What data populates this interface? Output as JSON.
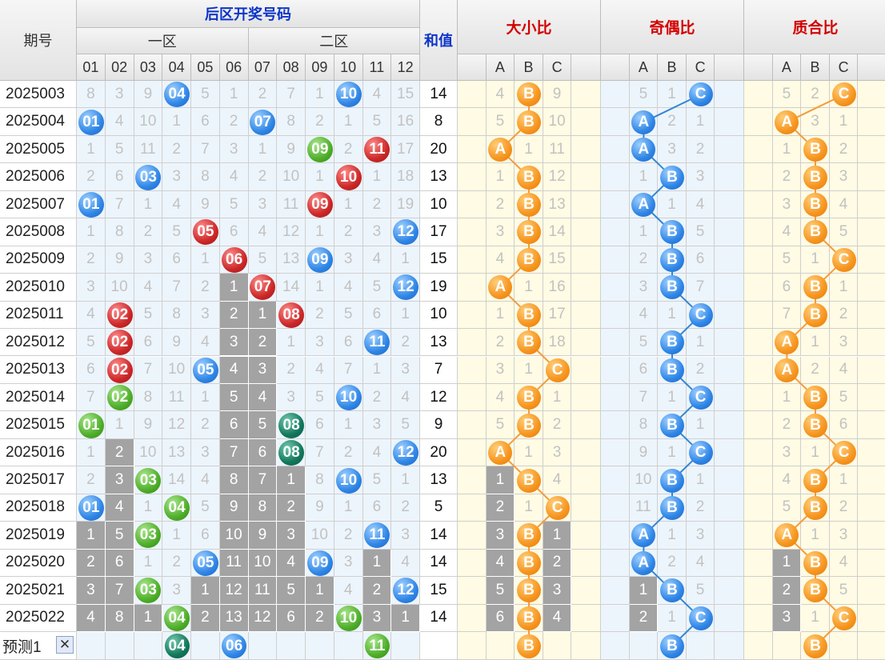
{
  "header": {
    "period_label": "期号",
    "back_zone_label": "后区开奖号码",
    "zone1_label": "一区",
    "zone2_label": "二区",
    "sum_label": "和值",
    "ratio_titles": [
      "大小比",
      "奇偶比",
      "质合比"
    ],
    "abc_labels": [
      "A",
      "B",
      "C"
    ],
    "number_labels": [
      "01",
      "02",
      "03",
      "04",
      "05",
      "06",
      "07",
      "08",
      "09",
      "10",
      "11",
      "12"
    ]
  },
  "colors": {
    "blue": "#2f86e6",
    "red": "#cc2828",
    "green": "#4fae2a",
    "teal": "#12775c",
    "orange": "#f6951f",
    "gray": "#a3a3a3",
    "line_orange": "#f49b3c",
    "line_blue": "#3487d3"
  },
  "chart_data": {
    "type": "table",
    "rows": [
      {
        "period": "2025003",
        "cells": [
          8,
          3,
          9,
          "04",
          5,
          1,
          2,
          7,
          1,
          "10",
          4,
          15
        ],
        "sum": 14,
        "dx": [
          4,
          "B",
          9
        ],
        "jo": [
          5,
          1,
          "C"
        ],
        "zh": [
          5,
          2,
          "C"
        ]
      },
      {
        "period": "2025004",
        "cells": [
          "01",
          4,
          10,
          1,
          6,
          2,
          "07",
          8,
          2,
          1,
          5,
          16
        ],
        "sum": 8,
        "dx": [
          5,
          "B",
          10
        ],
        "jo": [
          "A",
          2,
          1
        ],
        "zh": [
          "A",
          3,
          1
        ]
      },
      {
        "period": "2025005",
        "cells": [
          1,
          5,
          11,
          2,
          7,
          3,
          1,
          9,
          "09",
          2,
          "11",
          17
        ],
        "sum": 20,
        "dx": [
          "A",
          1,
          11
        ],
        "jo": [
          "A",
          3,
          2
        ],
        "zh": [
          1,
          "B",
          2
        ]
      },
      {
        "period": "2025006",
        "cells": [
          2,
          6,
          "03",
          3,
          8,
          4,
          2,
          10,
          1,
          "10",
          1,
          18
        ],
        "sum": 13,
        "dx": [
          1,
          "B",
          12
        ],
        "jo": [
          1,
          "B",
          3
        ],
        "zh": [
          2,
          "B",
          3
        ]
      },
      {
        "period": "2025007",
        "cells": [
          "01",
          7,
          1,
          4,
          9,
          5,
          3,
          11,
          "09",
          1,
          2,
          19
        ],
        "sum": 10,
        "dx": [
          2,
          "B",
          13
        ],
        "jo": [
          "A",
          1,
          4
        ],
        "zh": [
          3,
          "B",
          4
        ]
      },
      {
        "period": "2025008",
        "cells": [
          1,
          8,
          2,
          5,
          "05",
          6,
          4,
          12,
          1,
          2,
          3,
          "12"
        ],
        "sum": 17,
        "dx": [
          3,
          "B",
          14
        ],
        "jo": [
          1,
          "B",
          5
        ],
        "zh": [
          4,
          "B",
          5
        ]
      },
      {
        "period": "2025009",
        "cells": [
          2,
          9,
          3,
          6,
          1,
          "06",
          5,
          13,
          "09",
          3,
          4,
          1
        ],
        "sum": 15,
        "dx": [
          4,
          "B",
          15
        ],
        "jo": [
          2,
          "B",
          6
        ],
        "zh": [
          5,
          1,
          "C"
        ]
      },
      {
        "period": "2025010",
        "cells": [
          3,
          10,
          4,
          7,
          2,
          1,
          "07",
          14,
          1,
          4,
          5,
          "12"
        ],
        "sum": 19,
        "dx": [
          "A",
          1,
          16
        ],
        "jo": [
          3,
          "B",
          7
        ],
        "zh": [
          6,
          "B",
          1
        ]
      },
      {
        "period": "2025011",
        "cells": [
          4,
          "02",
          5,
          8,
          3,
          2,
          1,
          "08",
          2,
          5,
          6,
          1
        ],
        "sum": 10,
        "dx": [
          1,
          "B",
          17
        ],
        "jo": [
          4,
          1,
          "C"
        ],
        "zh": [
          7,
          "B",
          2
        ]
      },
      {
        "period": "2025012",
        "cells": [
          5,
          "02",
          6,
          9,
          4,
          3,
          2,
          1,
          3,
          6,
          "11",
          2
        ],
        "sum": 13,
        "dx": [
          2,
          "B",
          18
        ],
        "jo": [
          5,
          "B",
          1
        ],
        "zh": [
          "A",
          1,
          3
        ]
      },
      {
        "period": "2025013",
        "cells": [
          6,
          "02",
          7,
          10,
          "05",
          4,
          3,
          2,
          4,
          7,
          1,
          3
        ],
        "sum": 7,
        "dx": [
          3,
          1,
          "C"
        ],
        "jo": [
          6,
          "B",
          2
        ],
        "zh": [
          "A",
          2,
          4
        ]
      },
      {
        "period": "2025014",
        "cells": [
          7,
          "02",
          8,
          11,
          1,
          5,
          4,
          3,
          5,
          "10",
          2,
          4
        ],
        "sum": 12,
        "dx": [
          4,
          "B",
          1
        ],
        "jo": [
          7,
          1,
          "C"
        ],
        "zh": [
          1,
          "B",
          5
        ]
      },
      {
        "period": "2025015",
        "cells": [
          "01",
          1,
          9,
          12,
          2,
          6,
          5,
          "08",
          6,
          1,
          3,
          5
        ],
        "sum": 9,
        "dx": [
          5,
          "B",
          2
        ],
        "jo": [
          8,
          "B",
          1
        ],
        "zh": [
          2,
          "B",
          6
        ]
      },
      {
        "period": "2025016",
        "cells": [
          1,
          2,
          10,
          13,
          3,
          7,
          6,
          "08",
          7,
          2,
          4,
          "12"
        ],
        "sum": 20,
        "dx": [
          "A",
          1,
          3
        ],
        "jo": [
          9,
          1,
          "C"
        ],
        "zh": [
          3,
          1,
          "C"
        ]
      },
      {
        "period": "2025017",
        "cells": [
          2,
          3,
          "03",
          14,
          4,
          8,
          7,
          1,
          8,
          "10",
          5,
          1
        ],
        "sum": 13,
        "dx": [
          1,
          "B",
          4
        ],
        "jo": [
          10,
          "B",
          1
        ],
        "zh": [
          4,
          "B",
          1
        ]
      },
      {
        "period": "2025018",
        "cells": [
          "01",
          4,
          1,
          "04",
          5,
          9,
          8,
          2,
          9,
          1,
          6,
          2
        ],
        "sum": 5,
        "dx": [
          2,
          1,
          "C"
        ],
        "jo": [
          11,
          "B",
          2
        ],
        "zh": [
          5,
          "B",
          2
        ]
      },
      {
        "period": "2025019",
        "cells": [
          1,
          5,
          "03",
          1,
          6,
          10,
          9,
          3,
          10,
          2,
          "11",
          3
        ],
        "sum": 14,
        "dx": [
          3,
          "B",
          1
        ],
        "jo": [
          "A",
          1,
          3
        ],
        "zh": [
          "A",
          1,
          3
        ]
      },
      {
        "period": "2025020",
        "cells": [
          2,
          6,
          1,
          2,
          "05",
          11,
          10,
          4,
          "09",
          3,
          1,
          4
        ],
        "sum": 14,
        "dx": [
          4,
          "B",
          2
        ],
        "jo": [
          "A",
          2,
          4
        ],
        "zh": [
          1,
          "B",
          4
        ]
      },
      {
        "period": "2025021",
        "cells": [
          3,
          7,
          "03",
          3,
          1,
          12,
          11,
          5,
          1,
          4,
          2,
          "12"
        ],
        "sum": 15,
        "dx": [
          5,
          "B",
          3
        ],
        "jo": [
          1,
          "B",
          5
        ],
        "zh": [
          2,
          "B",
          5
        ]
      },
      {
        "period": "2025022",
        "cells": [
          4,
          8,
          1,
          "04",
          2,
          13,
          12,
          6,
          2,
          "10",
          3,
          1
        ],
        "sum": 14,
        "dx": [
          6,
          "B",
          4
        ],
        "jo": [
          2,
          1,
          "C"
        ],
        "zh": [
          3,
          1,
          "C"
        ]
      }
    ],
    "prediction": {
      "label": "预测1",
      "close_symbol": "✕",
      "numbers": [
        "04",
        "06",
        "11"
      ],
      "dx": "B",
      "jo": "B",
      "zh": "B"
    }
  }
}
